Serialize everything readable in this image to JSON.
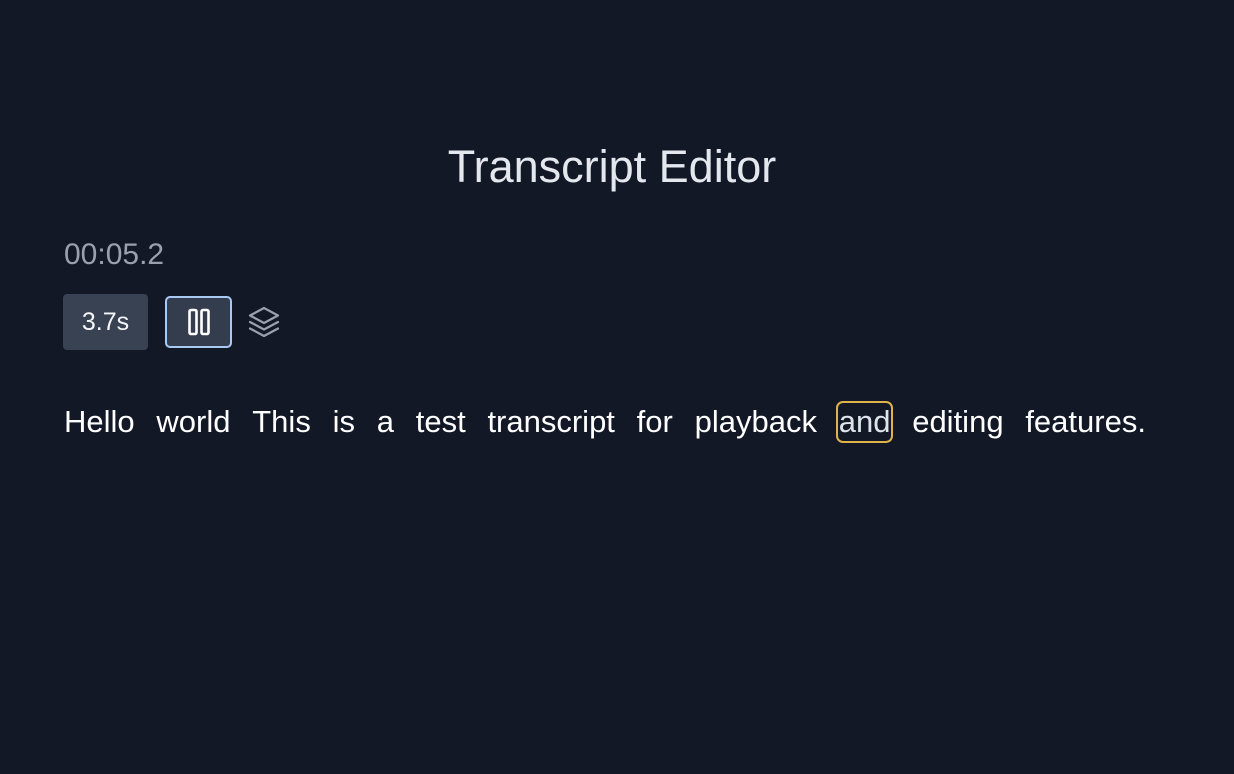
{
  "header": {
    "title": "Transcript Editor"
  },
  "player": {
    "timecode": "00:05.2",
    "speed_label": "3.7s",
    "pause_icon": "pause-icon",
    "layers_icon": "layers-icon"
  },
  "transcript": {
    "words": [
      "Hello",
      "world",
      "This",
      "is",
      "a",
      "test",
      "transcript",
      "for",
      "playback",
      "and",
      "editing",
      "features."
    ],
    "active_word": "and"
  },
  "colors": {
    "background": "#131826",
    "active_word_border": "#e0b24a",
    "pause_button_border": "#a9c9f5",
    "button_bg": "#394253"
  }
}
